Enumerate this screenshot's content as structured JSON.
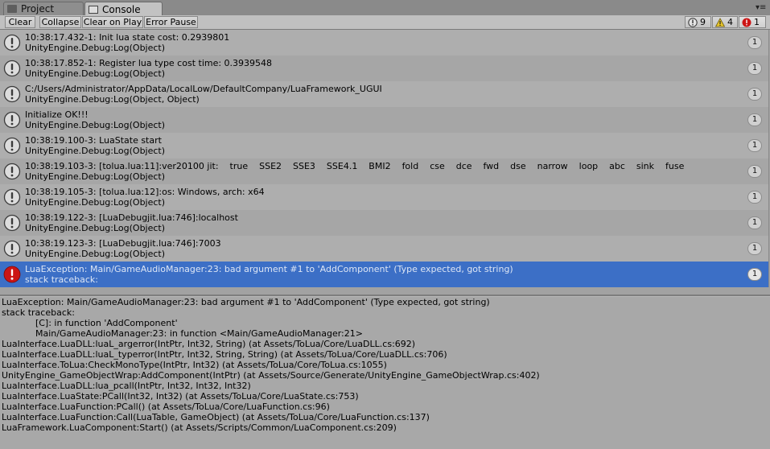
{
  "tabs": {
    "project": "Project",
    "console": "Console"
  },
  "toolbar": {
    "clear": "Clear",
    "collapse": "Collapse",
    "clear_on_play": "Clear on Play",
    "error_pause": "Error Pause",
    "log_count": "9",
    "warn_count": "4",
    "error_count": "1"
  },
  "colors": {
    "selected_row": "#3c6fc6",
    "error_red": "#cc1515",
    "warning_yellow": "#e7c52a"
  },
  "logs": [
    {
      "icon": "info-icon",
      "line1": "10:38:17.432-1: Init lua state cost: 0.2939801",
      "line2": "UnityEngine.Debug:Log(Object)",
      "count": "1"
    },
    {
      "icon": "info-icon",
      "line1": "10:38:17.852-1: Register lua type cost time: 0.3939548",
      "line2": "UnityEngine.Debug:Log(Object)",
      "count": "1"
    },
    {
      "icon": "info-icon",
      "line1": "C:/Users/Administrator/AppData/LocalLow/DefaultCompany/LuaFramework_UGUI",
      "line2": "UnityEngine.Debug:Log(Object, Object)",
      "count": "1"
    },
    {
      "icon": "info-icon",
      "line1": "Initialize OK!!!",
      "line2": "UnityEngine.Debug:Log(Object)",
      "count": "1"
    },
    {
      "icon": "info-icon",
      "line1": "10:38:19.100-3: LuaState start",
      "line2": "UnityEngine.Debug:Log(Object)",
      "count": "1"
    },
    {
      "icon": "info-icon",
      "line1": "10:38:19.103-3: [tolua.lua:11]:ver20100 jit:    true    SSE2    SSE3    SSE4.1    BMI2    fold    cse    dce    fwd    dse    narrow    loop    abc    sink    fuse",
      "line2": "UnityEngine.Debug:Log(Object)",
      "count": "1"
    },
    {
      "icon": "info-icon",
      "line1": "10:38:19.105-3: [tolua.lua:12]:os: Windows, arch: x64",
      "line2": "UnityEngine.Debug:Log(Object)",
      "count": "1"
    },
    {
      "icon": "info-icon",
      "line1": "10:38:19.122-3: [LuaDebugjit.lua:746]:localhost",
      "line2": "UnityEngine.Debug:Log(Object)",
      "count": "1"
    },
    {
      "icon": "info-icon",
      "line1": "10:38:19.123-3: [LuaDebugjit.lua:746]:7003",
      "line2": "UnityEngine.Debug:Log(Object)",
      "count": "1"
    },
    {
      "icon": "error-icon",
      "line1": "LuaException: Main/GameAudioManager:23: bad argument #1 to 'AddComponent' (Type expected, got string)",
      "line2": "stack traceback:",
      "count": "1"
    }
  ],
  "detail": [
    "LuaException: Main/GameAudioManager:23: bad argument #1 to 'AddComponent' (Type expected, got string)",
    "stack traceback:",
    "            [C]: in function 'AddComponent'",
    "            Main/GameAudioManager:23: in function <Main/GameAudioManager:21>",
    "LuaInterface.LuaDLL:luaL_argerror(IntPtr, Int32, String) (at Assets/ToLua/Core/LuaDLL.cs:692)",
    "LuaInterface.LuaDLL:luaL_typerror(IntPtr, Int32, String, String) (at Assets/ToLua/Core/LuaDLL.cs:706)",
    "LuaInterface.ToLua:CheckMonoType(IntPtr, Int32) (at Assets/ToLua/Core/ToLua.cs:1055)",
    "UnityEngine_GameObjectWrap:AddComponent(IntPtr) (at Assets/Source/Generate/UnityEngine_GameObjectWrap.cs:402)",
    "LuaInterface.LuaDLL:lua_pcall(IntPtr, Int32, Int32, Int32)",
    "LuaInterface.LuaState:PCall(Int32, Int32) (at Assets/ToLua/Core/LuaState.cs:753)",
    "LuaInterface.LuaFunction:PCall() (at Assets/ToLua/Core/LuaFunction.cs:96)",
    "LuaInterface.LuaFunction:Call(LuaTable, GameObject) (at Assets/ToLua/Core/LuaFunction.cs:137)",
    "LuaFramework.LuaComponent:Start() (at Assets/Scripts/Common/LuaComponent.cs:209)"
  ]
}
